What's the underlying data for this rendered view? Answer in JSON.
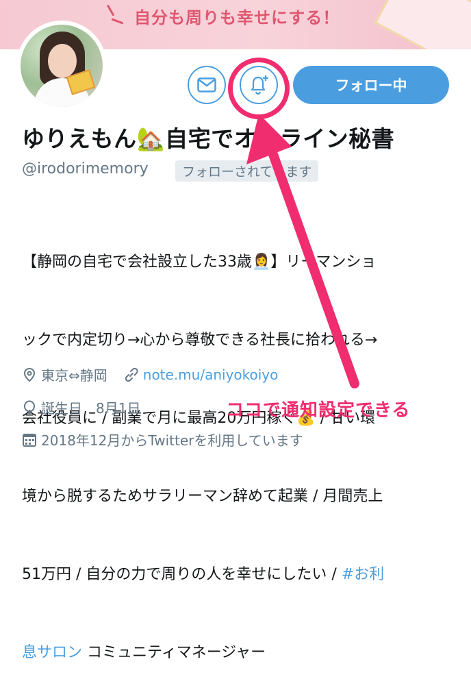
{
  "banner": {
    "text": "自分も周りも幸せにする！"
  },
  "actions": {
    "message_icon": "mail-icon",
    "notify_icon": "bell-plus-icon",
    "follow_label": "フォロー中"
  },
  "profile": {
    "display_name": "ゆりえもん🏡自宅でオンライン秘書",
    "handle": "@irodorimemory",
    "follows_you": "フォローされています",
    "bio_lines": [
      "【静岡の自宅で会社設立した33歳👩‍💼】リーマンショ",
      "ックで内定切り→心から尊敬できる社長に拾われる→",
      "会社役員に / 副業で月に最高20万円稼ぐ💰 / 甘い環",
      "境から脱するためサラリーマン辞めて起業 / 月間売上",
      "51万円 / 自分の力で周りの人を幸せにしたい / "
    ],
    "bio_hashtag": "#お利息サロン",
    "bio_hashtag_line": "#お利",
    "bio_last_line_tag": "息サロン",
    "bio_last_line_rest": " コミュニティマネージャー",
    "location": "東京⇔静岡",
    "link": "note.mu/aniyokoiyo",
    "birthday_label": "誕生日",
    "birthday_value": "8月1日",
    "joined": "2018年12月からTwitterを利用しています"
  },
  "annotation": {
    "text": "ココで通知設定できる"
  },
  "colors": {
    "accent": "#4a9ee0",
    "highlight": "#f02d6e",
    "muted": "#657786"
  }
}
